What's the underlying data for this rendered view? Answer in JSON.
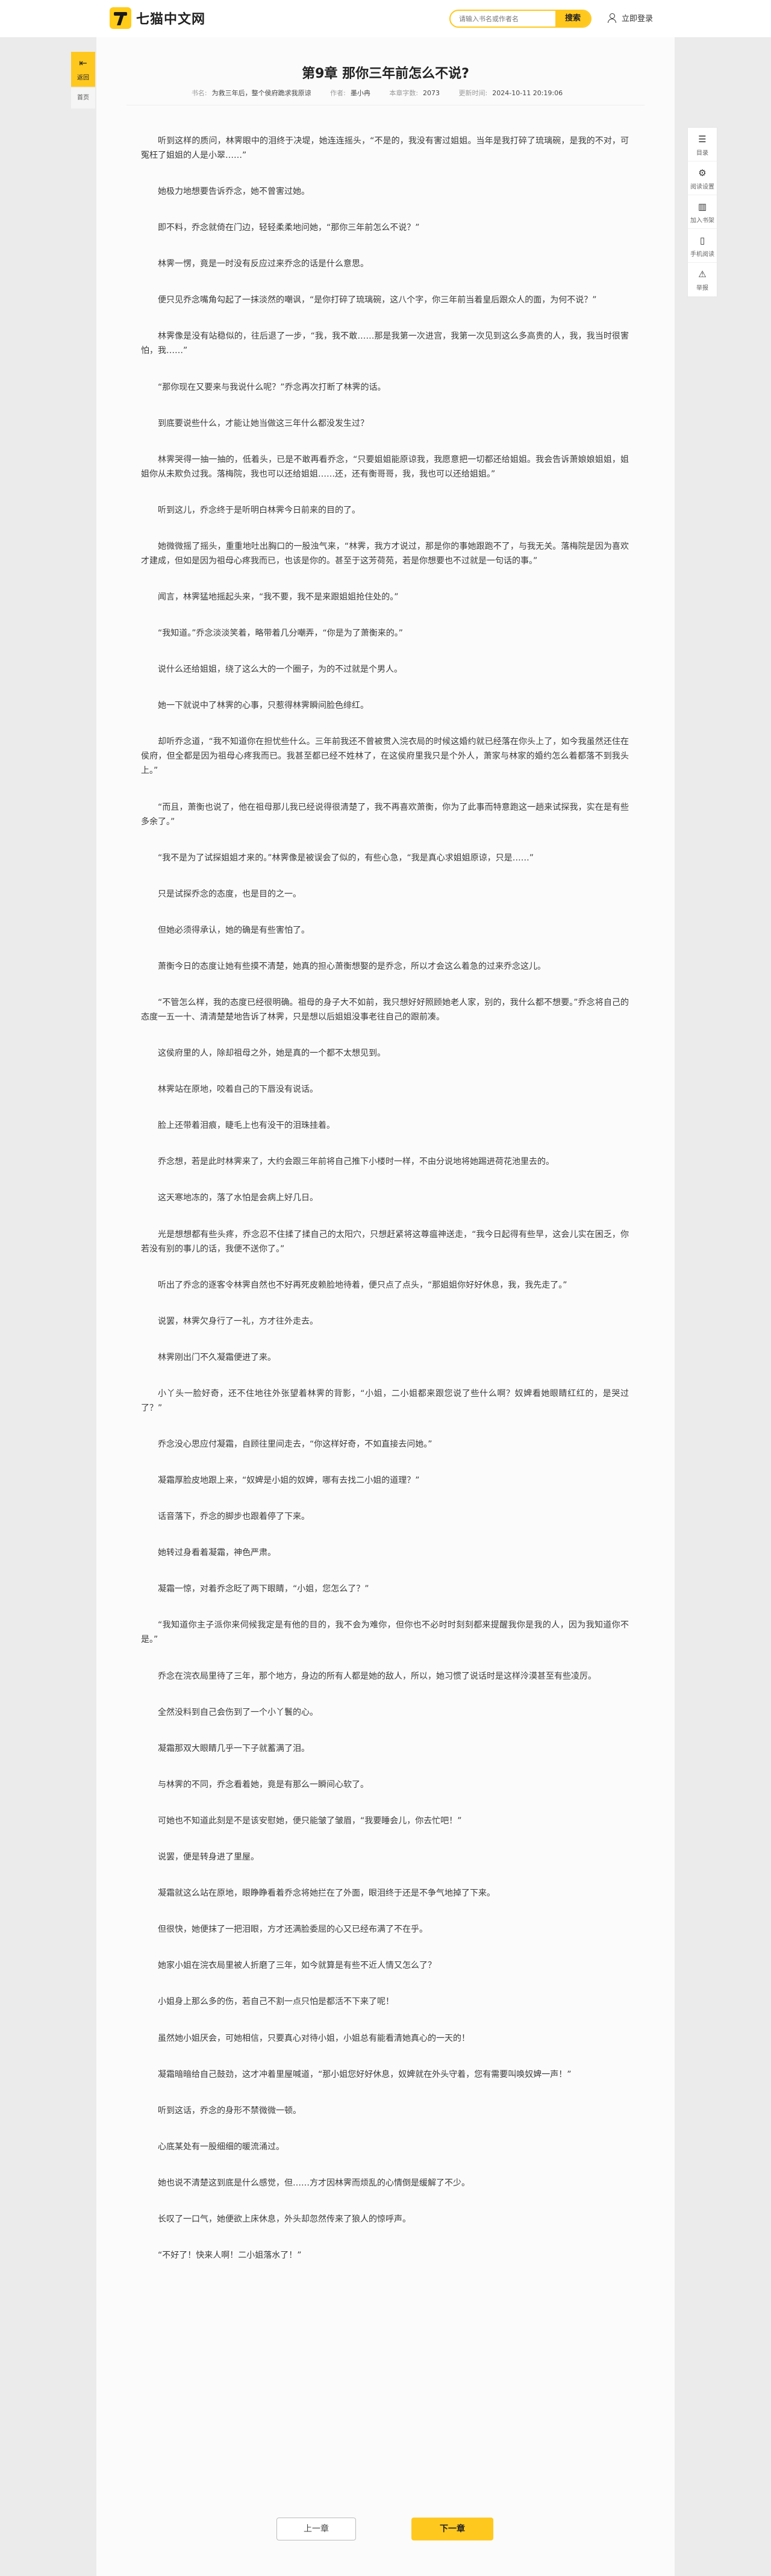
{
  "header": {
    "logo_text": "七猫中文网",
    "search_placeholder": "请输入书名或作者名",
    "search_button": "搜索",
    "login_label": "立即登录"
  },
  "left_tools": {
    "back_label": "返回",
    "home_label": "首页"
  },
  "right_tools": [
    {
      "icon": "catalog-icon",
      "glyph": "☰",
      "label": "目录"
    },
    {
      "icon": "settings-icon",
      "glyph": "⚙",
      "label": "阅读设置"
    },
    {
      "icon": "bookshelf-icon",
      "glyph": "▥",
      "label": "加入书架"
    },
    {
      "icon": "phone-icon",
      "glyph": "▯",
      "label": "手机阅读"
    },
    {
      "icon": "report-icon",
      "glyph": "⚠",
      "label": "举报"
    }
  ],
  "chapter": {
    "title": "第9章 那你三年前怎么不说?",
    "book_label": "书名:",
    "book_value": "为救三年后，整个侯府跪求我原谅",
    "author_label": "作者:",
    "author_value": "墨小冉",
    "words_label": "本章字数:",
    "words_value": "2073",
    "updated_label": "更新时间:",
    "updated_value": "2024-10-11 20:19:06"
  },
  "paragraphs": [
    "听到这样的质问，林霁眼中的泪终于决堤，她连连摇头，“不是的，我没有害过姐姐。当年是我打碎了琉璃碗，是我的不对，可冤枉了姐姐的人是小翠……”",
    "她极力地想要告诉乔念，她不曾害过她。",
    "即不料，乔念就倚在门边，轻轻柔柔地问她，“那你三年前怎么不说？”",
    "林霁一愣，竟是一时没有反应过来乔念的话是什么意思。",
    "便只见乔念嘴角勾起了一抹淡然的嘲讽，“是你打碎了琉璃碗，这八个字，你三年前当着皇后跟众人的面，为何不说？”",
    "林霁像是没有站稳似的，往后退了一步，“我，我不敢……那是我第一次进宫，我第一次见到这么多高贵的人，我，我当时很害怕，我……”",
    "“那你现在又要来与我说什么呢？”乔念再次打断了林霁的话。",
    "到底要说些什么，才能让她当做这三年什么都没发生过？",
    "林霁哭得一抽一抽的，低着头，已是不敢再看乔念，“只要姐姐能原谅我，我愿意把一切都还给姐姐。我会告诉萧娘娘姐姐，姐姐你从未欺负过我。落梅院，我也可以还给姐姐……还，还有衡哥哥，我，我也可以还给姐姐。”",
    "听到这儿，乔念终于是听明白林霁今日前来的目的了。",
    "她微微摇了摇头，重重地吐出胸口的一股浊气来，“林霁，我方才说过，那是你的事她跟跑不了，与我无关。落梅院是因为喜欢才建成，但如是因为祖母心疼我而已，也该是你的。甚至于这芳荷苑，若是你想要也不过就是一句话的事。”",
    "闻言，林霁猛地摇起头来，“我不要，我不是来跟姐姐抢住处的。”",
    "“我知道。”乔念淡淡笑着，略带着几分嘲弄，“你是为了萧衡来的。”",
    "说什么还给姐姐，绕了这么大的一个圈子，为的不过就是个男人。",
    "她一下就说中了林霁的心事，只惹得林霁瞬间脸色绯红。",
    "却听乔念道，“我不知道你在担忧些什么。三年前我还不曾被贯入浣衣局的时候这婚约就已经落在你头上了，如今我虽然还住在侯府，但全都是因为祖母心疼我而已。我甚至都已经不姓林了，在这侯府里我只是个外人，萧家与林家的婚约怎么着都落不到我头上。”",
    "“而且，萧衡也说了，他在祖母那儿我已经说得很清楚了，我不再喜欢萧衡，你为了此事而特意跑这一趟来试探我，实在是有些多余了。”",
    "“我不是为了试探姐姐才来的。”林霁像是被误会了似的，有些心急，“我是真心求姐姐原谅，只是……”",
    "只是试探乔念的态度，也是目的之一。",
    "但她必须得承认，她的确是有些害怕了。",
    "萧衡今日的态度让她有些摸不清楚，她真的担心萧衡想娶的是乔念，所以才会这么着急的过来乔念这儿。",
    "“不管怎么样，我的态度已经很明确。祖母的身子大不如前，我只想好好照顾她老人家，别的，我什么都不想要。”乔念将自己的态度一五一十、清清楚楚地告诉了林霁，只是想以后姐姐没事老往自己的跟前凑。",
    "这侯府里的人，除却祖母之外，她是真的一个都不太想见到。",
    "林霁站在原地，咬着自己的下唇没有说话。",
    "脸上还带着泪痕，睫毛上也有没干的泪珠挂着。",
    "乔念想，若是此时林霁来了，大约会跟三年前将自己推下小楼时一样，不由分说地将她踢进荷花池里去的。",
    "这天寒地冻的，落了水怕是会病上好几日。",
    "光是想想都有些头疼，乔念忍不住揉了揉自己的太阳穴，只想赶紧将这尊瘟神送走，“我今日起得有些早，这会儿实在困乏，你若没有别的事儿的话，我便不送你了。”",
    "听出了乔念的逐客令林霁自然也不好再死皮赖脸地待着，便只点了点头，“那姐姐你好好休息，我，我先走了。”",
    "说罢，林霁欠身行了一礼，方才往外走去。",
    "林霁刚出门不久凝霜便进了来。",
    "小丫头一脸好奇，还不住地往外张望着林霁的背影，“小姐，二小姐都来跟您说了些什么啊？奴婢看她眼睛红红的，是哭过了？”",
    "乔念没心思应付凝霜，自顾往里间走去，“你这样好奇，不如直接去问她。”",
    "凝霜厚脸皮地跟上来，“奴婢是小姐的奴婢，哪有去找二小姐的道理？”",
    "话音落下，乔念的脚步也跟着停了下来。",
    "她转过身看着凝霜，神色严肃。",
    "凝霜一惊，对着乔念眨了两下眼睛，“小姐，您怎么了？”",
    "“我知道你主子派你来伺候我定是有他的目的，我不会为难你，但你也不必时时刻刻都来提醒我你是我的人，因为我知道你不是。”",
    "乔念在浣衣局里待了三年，那个地方，身边的所有人都是她的敌人，所以，她习惯了说话时是这样泠漠甚至有些凌厉。",
    "全然没料到自己会伤到了一个小丫鬟的心。",
    "凝霜那双大眼睛几乎一下子就蓄满了泪。",
    "与林霁的不同，乔念看着她，竟是有那么一瞬间心软了。",
    "可她也不知道此刻是不是该安慰她，便只能皱了皱眉，“我要睡会儿，你去忙吧！”",
    "说罢，便是转身进了里屋。",
    "凝霜就这么站在原地，眼睁睁看着乔念将她拦在了外面，眼泪终于还是不争气地掉了下来。",
    "但很快，她便抹了一把泪眼，方才还满脸委屈的心又已经布满了不在乎。",
    "她家小姐在浣衣局里被人折磨了三年，如今就算是有些不近人情又怎么了？",
    "小姐身上那么多的伤，若自己不割一点只怕是都活不下来了呢！",
    "虽然她小姐厌会，可她相信，只要真心对待小姐，小姐总有能看清她真心的一天的！",
    "凝霜暗暗给自己鼓劲，这才冲着里屋喊道，“那小姐您好好休息，奴婢就在外头守着，您有需要叫唤奴婢一声！”",
    "听到这话，乔念的身形不禁微微一顿。",
    "心底某处有一股细细的暖流涌过。",
    "她也说不清楚这到底是什么感觉，但……方才因林霁而烦乱的心情倒是缓解了不少。",
    "长叹了一口气，她便欲上床休息，外头却忽然传来了狼人的惊呼声。",
    "“不好了！快来人啊！二小姐落水了！”"
  ],
  "navigation": {
    "prev_label": "上一章",
    "next_label": "下一章"
  }
}
